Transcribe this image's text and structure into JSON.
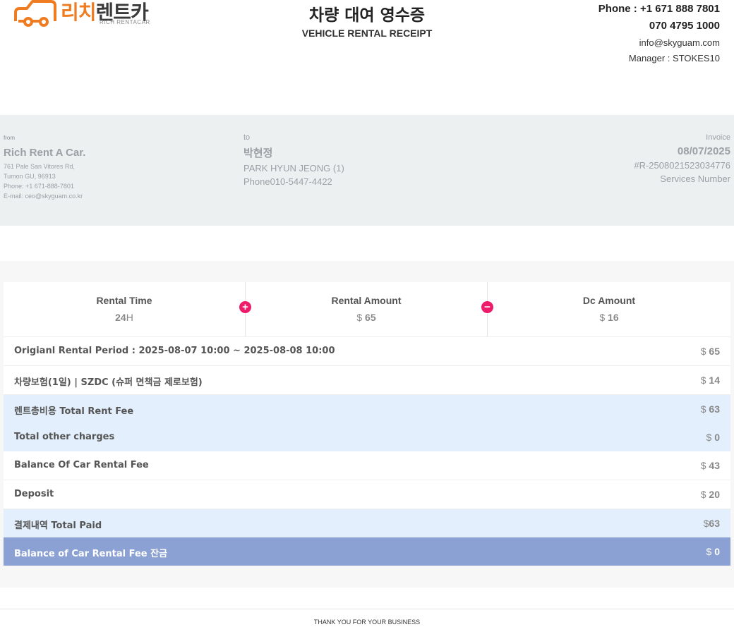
{
  "logo": {
    "ko_part1": "리치",
    "ko_part2": "렌트카",
    "en": "RICH RENTACAR"
  },
  "header": {
    "title_ko": "차량 대여 영수증",
    "title_en": "VEHICLE RENTAL RECEIPT",
    "phone1": "Phone : +1 671 888 7801",
    "phone2": "070 4795 1000",
    "email": "info@skyguam.com",
    "manager": "Manager : STOKES10"
  },
  "from": {
    "label": "from",
    "name": "Rich Rent A Car.",
    "address1": "761 Pale San Vitores Rd,",
    "address2": "Tumon GU, 96913",
    "phone": "Phone: +1 671-888-7801",
    "email": "E-mail: ceo@skyguam.co.kr"
  },
  "to": {
    "label": "to",
    "name_ko": "박현정",
    "name_en": "PARK HYUN JEONG (1)",
    "phone": "Phone010-5447-4422"
  },
  "invoice": {
    "label": "Invoice",
    "date": "08/07/2025",
    "number": "#R-2508021523034776",
    "services": "Services Number"
  },
  "summary": {
    "rental_time_label": "Rental Time",
    "rental_time_value": "24",
    "rental_time_unit": "H",
    "rental_amount_label": "Rental Amount",
    "rental_amount_currency": "$",
    "rental_amount_value": "65",
    "dc_amount_label": "Dc Amount",
    "dc_amount_currency": "$",
    "dc_amount_value": "16"
  },
  "rows": [
    {
      "label": "Origianl Rental Period : 2025-08-07 10:00 ~ 2025-08-08 10:00",
      "currency": "$",
      "amount": "65"
    },
    {
      "label": "차량보험(1일) | SZDC (슈퍼 면책금 제로보험)",
      "currency": "$",
      "amount": "14"
    },
    {
      "label": "렌트총비용 Total Rent Fee",
      "currency": "$",
      "amount": "63"
    },
    {
      "label": "Total other charges",
      "currency": "$",
      "amount": "0"
    },
    {
      "label": "Balance Of Car Rental Fee",
      "currency": "$",
      "amount": "43"
    },
    {
      "label": "Deposit",
      "currency": "$",
      "amount": "20"
    },
    {
      "label": "결제내역 Total Paid",
      "currency": "$",
      "amount": "63"
    },
    {
      "label": "Balance of Car Rental Fee 잔금",
      "currency": "$",
      "amount": "0"
    }
  ],
  "footer": {
    "text": "THANK YOU FOR YOUR BUSINESS"
  },
  "colors": {
    "brand_orange": "#f07c22",
    "accent_pink": "#ee1b6b",
    "row_blue": "#e3effc",
    "row_dark": "#8ba1d4"
  }
}
